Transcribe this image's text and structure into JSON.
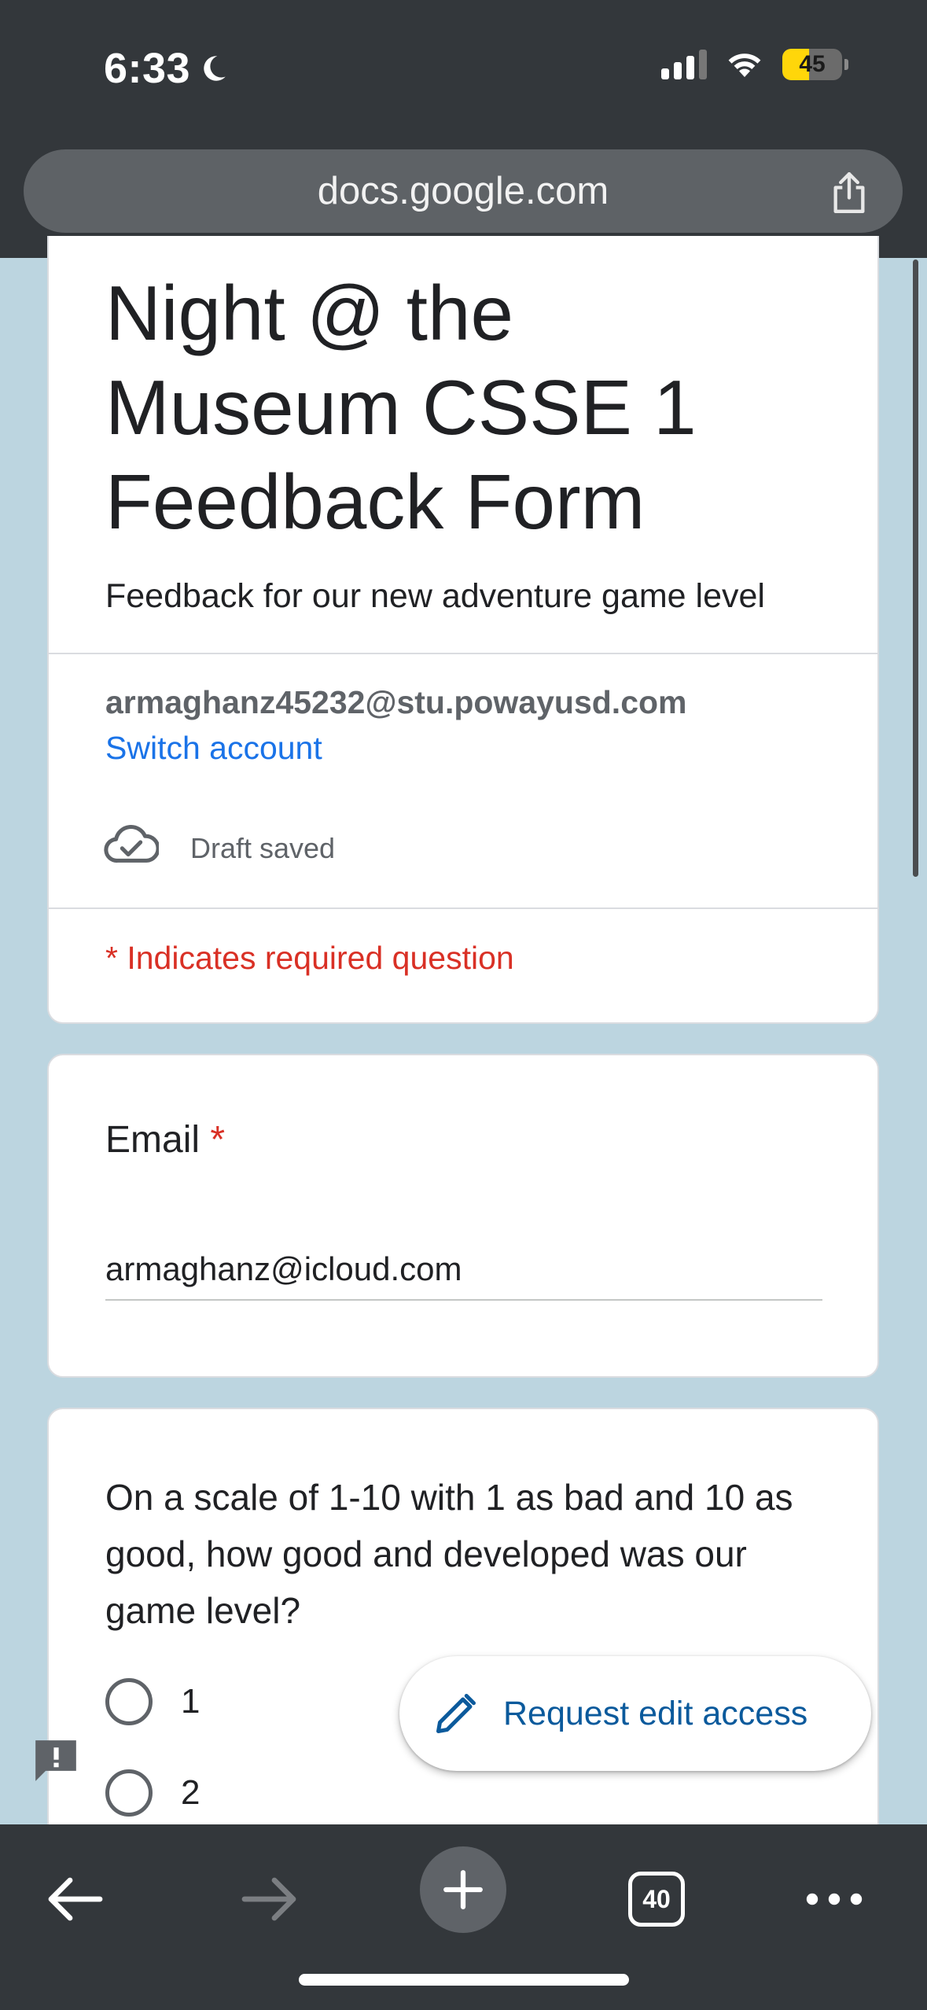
{
  "status_bar": {
    "time": "6:33",
    "battery_level": "45",
    "battery_fraction": 0.45
  },
  "browser": {
    "url": "docs.google.com",
    "tab_count": "40"
  },
  "form": {
    "title": "Night @ the Museum CSSE 1 Feedback Form",
    "description": "Feedback for our new adventure game level",
    "account_email": "armaghanz45232@stu.powayusd.com",
    "switch_account": "Switch account",
    "draft_status": "Draft saved",
    "required_note": "* Indicates required question"
  },
  "questions": {
    "email": {
      "label": "Email",
      "required_mark": "*",
      "value": "armaghanz@icloud.com"
    },
    "scale": {
      "text": "On a scale of 1-10 with 1 as bad and 10 as good, how good and developed was our game level?",
      "options": [
        "1",
        "2"
      ]
    }
  },
  "actions": {
    "request_edit": "Request edit access"
  },
  "icons": {
    "moon": "moon-icon",
    "signal": "cellular-signal-icon",
    "wifi": "wifi-icon",
    "share": "share-icon",
    "cloud": "cloud-check-icon",
    "pencil": "pencil-icon",
    "feedback": "report-feedback-icon",
    "back": "back-arrow-icon",
    "forward": "forward-arrow-icon",
    "new_tab": "plus-icon",
    "more": "more-dots-icon"
  },
  "colors": {
    "accent_blue": "#1a73e8",
    "required_red": "#d93025",
    "page_bg": "#bcd5e0",
    "chrome_dark": "#33373b"
  }
}
